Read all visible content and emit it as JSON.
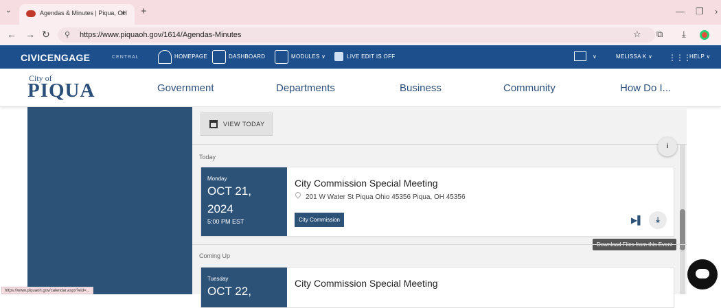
{
  "browser": {
    "tab_title": "Agendas & Minutes | Piqua, OH",
    "url": "https://www.piquaoh.gov/1614/Agendas-Minutes",
    "status_url": "https://www.piquaoh.gov/calendar.aspx?eid=..."
  },
  "admin_bar": {
    "brand": "CIVICENGAGE",
    "brand_sub": "CENTRAL",
    "items": {
      "homepage": "HOMEPAGE",
      "dashboard": "DASHBOARD",
      "modules": "MODULES ∨",
      "live_edit": "LIVE EDIT IS OFF"
    },
    "mail_caret": "∨",
    "user": "MELISSA K ∨",
    "help": "HELP ∨"
  },
  "site": {
    "city_of": "City of",
    "name": "PIQUA",
    "nav": [
      "Government",
      "Departments",
      "Business",
      "Community",
      "How Do I..."
    ]
  },
  "calendar": {
    "view_today_label": "VIEW TODAY",
    "info_label": "i",
    "groups": {
      "today": "Today",
      "coming_up": "Coming Up"
    },
    "events": [
      {
        "day": "Monday",
        "month_day": "OCT 21,",
        "year": "2024",
        "time": "5:00 PM EST",
        "title": "City Commission Special Meeting",
        "address": "201 W Water St Piqua Ohio 45356 Piqua, OH 45356",
        "tag": "City Commission"
      },
      {
        "day": "Tuesday",
        "month_day": "OCT 22,",
        "title": "City Commission Special Meeting"
      }
    ],
    "tooltip": "Download Files from this Event"
  },
  "colors": {
    "admin_bar": "#1d4f8c",
    "brand_navy": "#2d5278",
    "tab_bar": "#f6dde2"
  }
}
